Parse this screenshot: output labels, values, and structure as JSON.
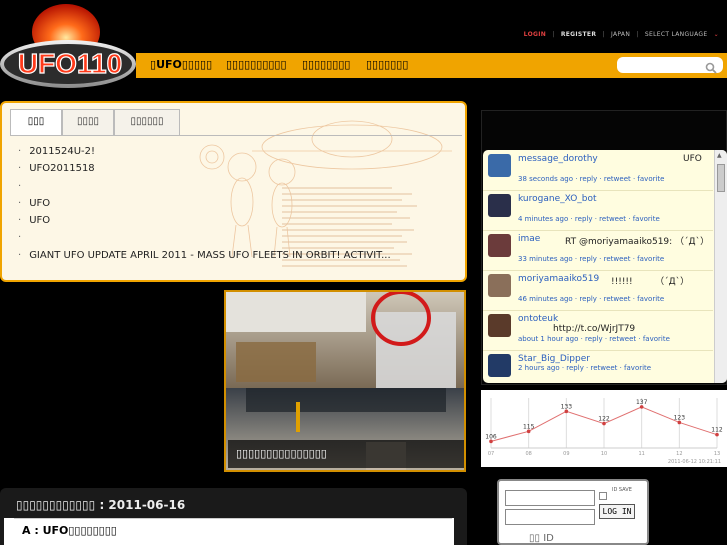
{
  "logo": {
    "text": "UFO110"
  },
  "top_links": {
    "login": "LOGIN",
    "register": "REGISTER",
    "japan": "JAPAN",
    "language": "SELECT LANGUAGE"
  },
  "nav": {
    "items": [
      "UFO",
      "",
      "",
      ""
    ]
  },
  "tabs": [
    "",
    "",
    ""
  ],
  "news": [
    "2011524U-2!",
    "UFO2011518",
    "",
    "UFO",
    "UFO",
    "",
    "GIANT UFO UPDATE APRIL 2011 - MASS UFO FLEETS IN ORBIT! ACTIVIT..."
  ],
  "photo": {
    "caption": ""
  },
  "twitter": [
    {
      "user": "message_dorothy",
      "text": "UFO",
      "meta": "38 seconds ago · reply · retweet · favorite",
      "avatar_color": "#3a6aa8"
    },
    {
      "user": "kurogane_XO_bot",
      "text": "",
      "meta": "4 minutes ago · reply · retweet · favorite",
      "avatar_color": "#2a2f4a"
    },
    {
      "user": "imae",
      "text": "RT @moriyamaaiko519: （´Д`）",
      "meta": "33 minutes ago · reply · retweet · favorite",
      "avatar_color": "#6b3b3b"
    },
    {
      "user": "moriyamaaiko519",
      "text": "!!!!!!　　　（´Д`）",
      "meta": "46 minutes ago · reply · retweet · favorite",
      "avatar_color": "#8a6f5a"
    },
    {
      "user": "ontoteuk",
      "text": "http://t.co/WjrJT79",
      "meta": "about 1 hour ago · reply · retweet · favorite",
      "avatar_color": "#5a3a2a"
    },
    {
      "user": "Star_Big_Dipper",
      "text": "",
      "meta": "2 hours ago · reply · retweet · favorite",
      "avatar_color": "#223a66"
    }
  ],
  "chart_data": {
    "type": "line",
    "x": [
      "07",
      "08",
      "09",
      "10",
      "11",
      "12",
      "13"
    ],
    "values": [
      106,
      115,
      133,
      122,
      137,
      123,
      112
    ],
    "footer": "2011-06-12 10:21:11"
  },
  "date_section": {
    "title": ": 2011-06-16",
    "subtitle": "A : UFO"
  },
  "login_box": {
    "id_save": "ID SAVE",
    "button": "LOG IN",
    "id_label": "ID"
  },
  "colors": {
    "accent": "#f0a400",
    "link": "#2b5fbe",
    "login_red": "#e04040"
  }
}
